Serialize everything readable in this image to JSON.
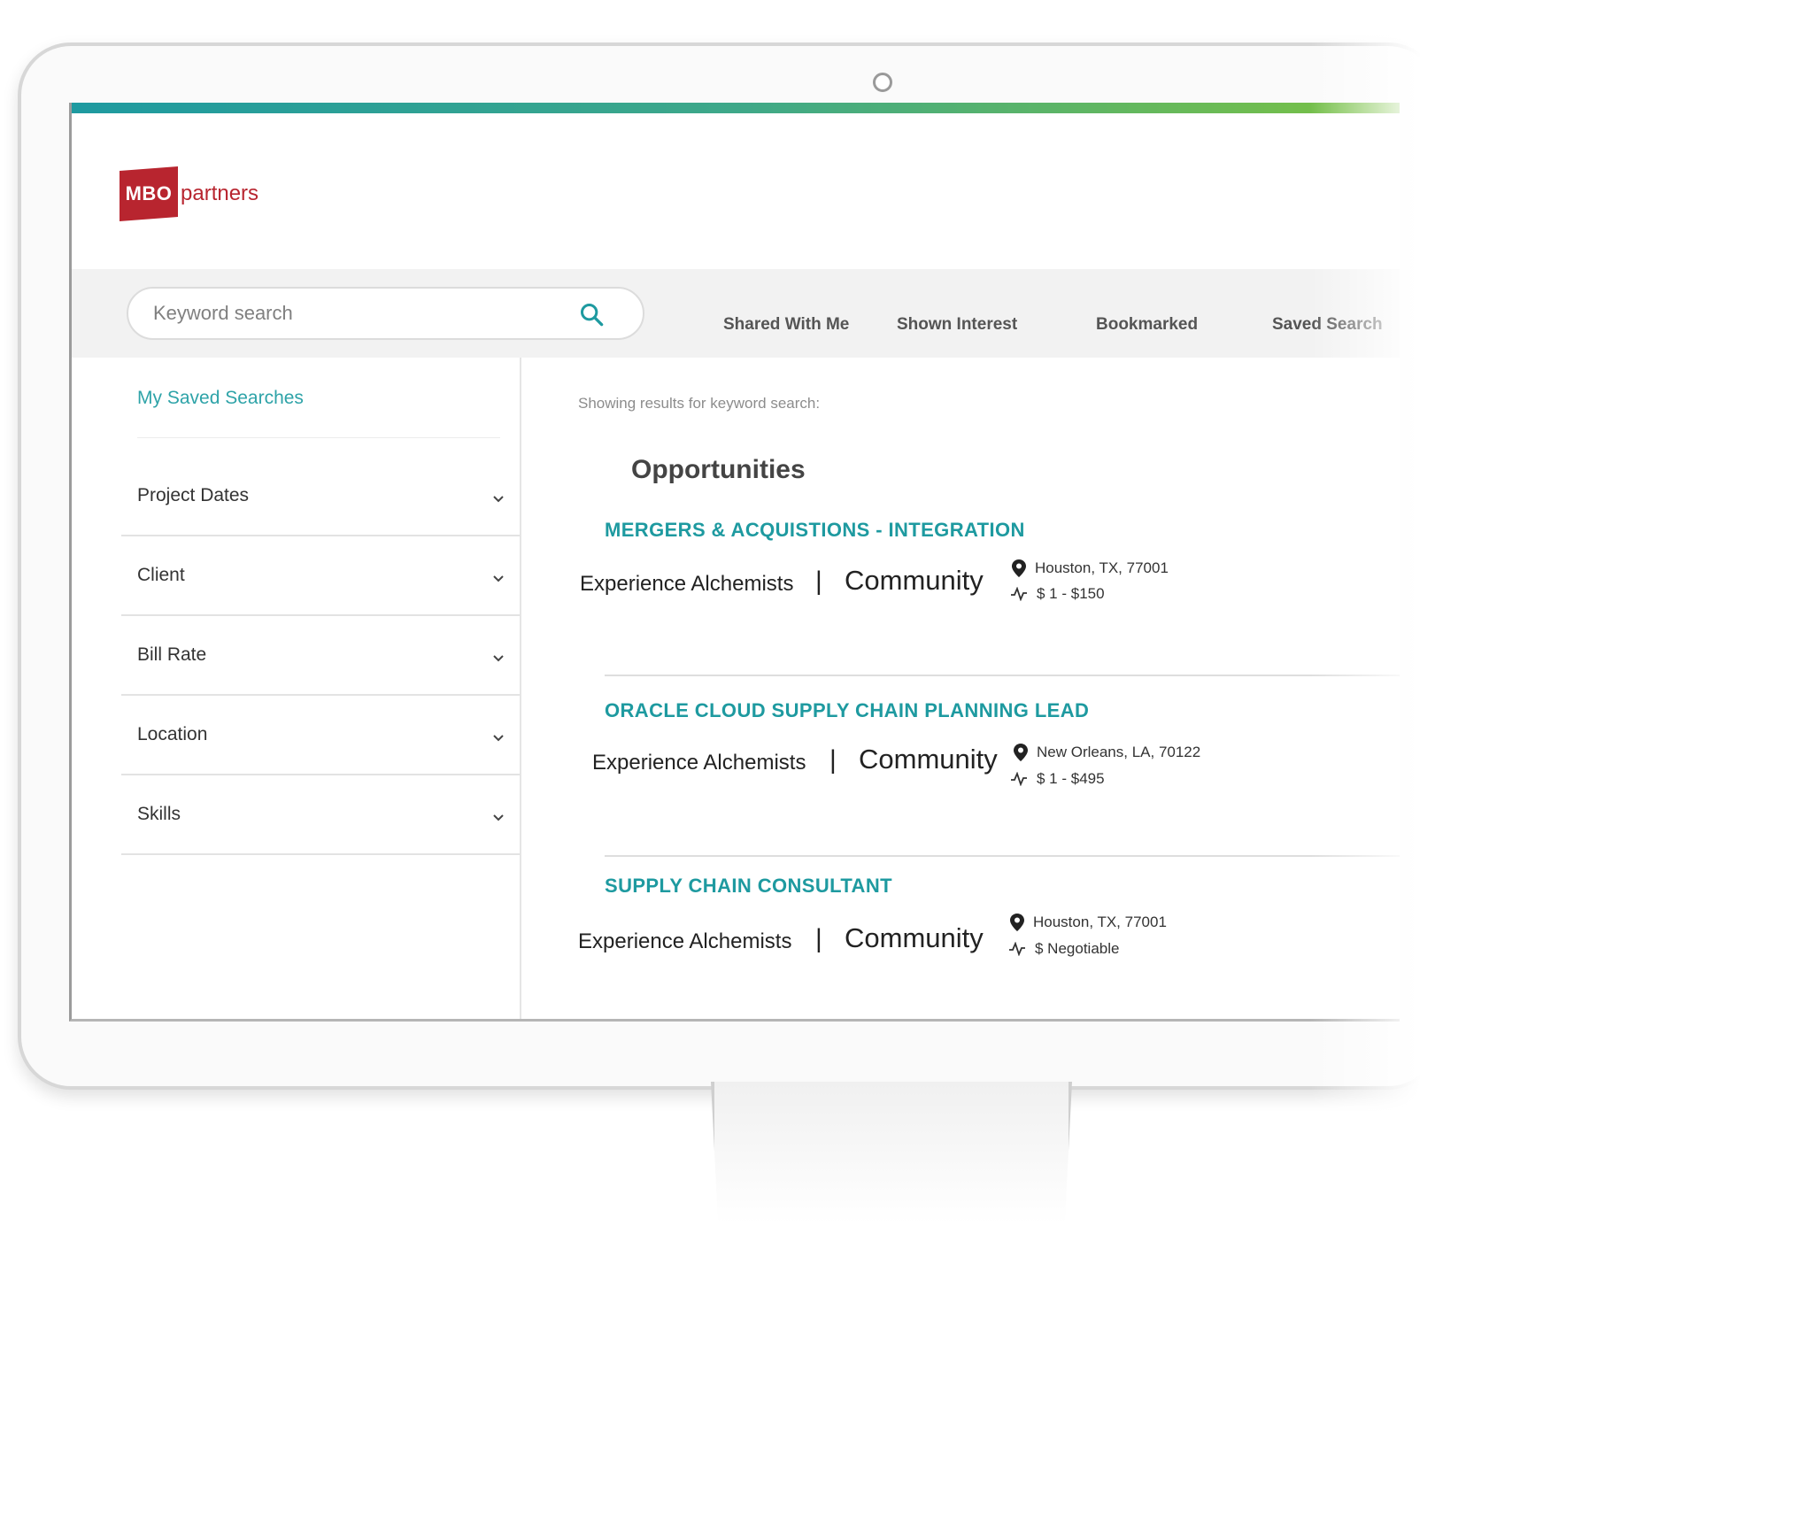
{
  "logo": {
    "badge": "MBO",
    "wordmark": "partners"
  },
  "search": {
    "placeholder": "Keyword search"
  },
  "tabs": [
    {
      "label": "Shared With Me"
    },
    {
      "label": "Shown Interest"
    },
    {
      "label": "Bookmarked"
    },
    {
      "label": "Saved Search"
    }
  ],
  "sidebar": {
    "saved_searches": "My Saved Searches",
    "filters": [
      {
        "label": "Project Dates"
      },
      {
        "label": "Client"
      },
      {
        "label": "Bill Rate"
      },
      {
        "label": "Location"
      },
      {
        "label": "Skills"
      }
    ]
  },
  "main": {
    "showing": "Showing results for keyword search:",
    "title": "Opportunities",
    "results": [
      {
        "title": "MERGERS & ACQUISTIONS - INTEGRATION",
        "company": "Experience Alchemists",
        "separator": "|",
        "network": "Community",
        "location": "Houston, TX, 77001",
        "rate": "$ 1 - $150"
      },
      {
        "title": "ORACLE CLOUD SUPPLY CHAIN PLANNING LEAD",
        "company": "Experience Alchemists",
        "separator": "|",
        "network": "Community",
        "location": "New Orleans, LA, 70122",
        "rate": "$ 1 - $495"
      },
      {
        "title": "SUPPLY CHAIN CONSULTANT",
        "company": "Experience Alchemists",
        "separator": "|",
        "network": "Community",
        "location": "Houston, TX, 77001",
        "rate": "$ Negotiable"
      }
    ]
  },
  "colors": {
    "accent": "#1e9aa0",
    "brand_red": "#b8252f",
    "gradient_start": "#1e9aa0",
    "gradient_end": "#7cc242"
  },
  "icons": [
    "search-icon",
    "chevron-down-icon",
    "map-pin-icon",
    "activity-icon",
    "camera-icon"
  ]
}
